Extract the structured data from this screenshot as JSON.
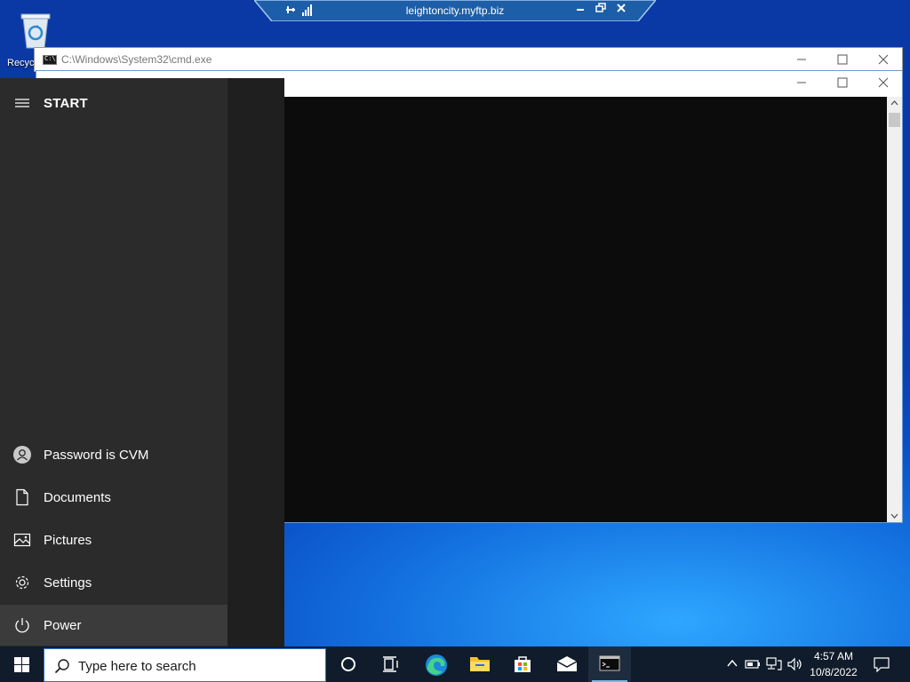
{
  "desktop": {
    "icons": [
      {
        "label": "Recyc",
        "icon": "recycle-bin-icon"
      }
    ]
  },
  "rdp_bar": {
    "title": "leightoncity.myftp.biz",
    "buttons": [
      "pin",
      "signal",
      "minimize",
      "restore",
      "close"
    ]
  },
  "windows": [
    {
      "title": "C:\\Windows\\System32\\cmd.exe",
      "buttons": [
        "minimize",
        "maximize",
        "close"
      ]
    },
    {
      "title": "",
      "buttons": [
        "minimize",
        "maximize",
        "close"
      ]
    }
  ],
  "start_menu": {
    "title": "START",
    "items": [
      {
        "label": "Password is CVM",
        "icon": "user-icon"
      },
      {
        "label": "Documents",
        "icon": "document-icon"
      },
      {
        "label": "Pictures",
        "icon": "pictures-icon"
      },
      {
        "label": "Settings",
        "icon": "gear-icon"
      },
      {
        "label": "Power",
        "icon": "power-icon",
        "highlighted": true
      }
    ]
  },
  "taskbar": {
    "search_placeholder": "Type here to search",
    "pinned": [
      "cortana-icon",
      "task-view-icon",
      "edge-icon",
      "file-explorer-icon",
      "store-icon",
      "mail-icon",
      "cmd-icon"
    ],
    "running": "cmd-icon",
    "tray": [
      "chevron-up-icon",
      "battery-icon",
      "network-icon",
      "volume-icon"
    ],
    "clock": {
      "time": "4:57 AM",
      "date": "10/8/2022"
    },
    "notification_icon": "notification-icon"
  },
  "colors": {
    "accent": "#0078d7",
    "taskbar": "#101c2b",
    "start_menu": "#2b2b2b",
    "console": "#0c0c0c"
  }
}
